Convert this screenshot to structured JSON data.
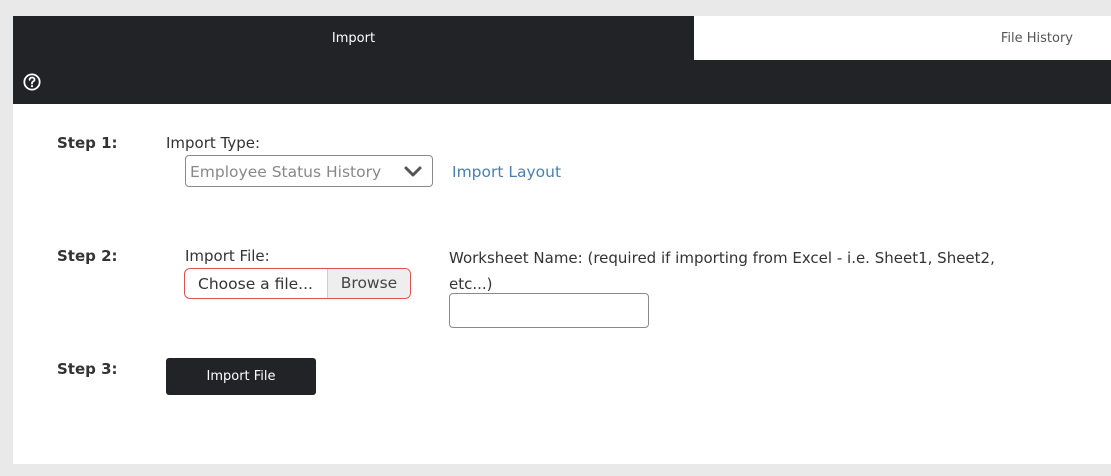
{
  "tabs": {
    "import": "Import",
    "file_history": "File History"
  },
  "steps": {
    "step1": {
      "label": "Step 1:",
      "field_label": "Import Type:",
      "select_value": "Employee Status History",
      "link_text": "Import Layout"
    },
    "step2": {
      "label": "Step 2:",
      "field_label": "Import File:",
      "file_placeholder": "Choose a file...",
      "browse_label": "Browse",
      "worksheet_label": "Worksheet Name: (required if importing from Excel - i.e. Sheet1, Sheet2, etc...)",
      "worksheet_value": ""
    },
    "step3": {
      "label": "Step 3:",
      "button_label": "Import File"
    }
  },
  "icons": {
    "help": "help-icon",
    "chevron": "chevron-down-icon"
  },
  "colors": {
    "dark_bar": "#212327",
    "link": "#4a7fb0",
    "error_border": "#d9534f"
  }
}
